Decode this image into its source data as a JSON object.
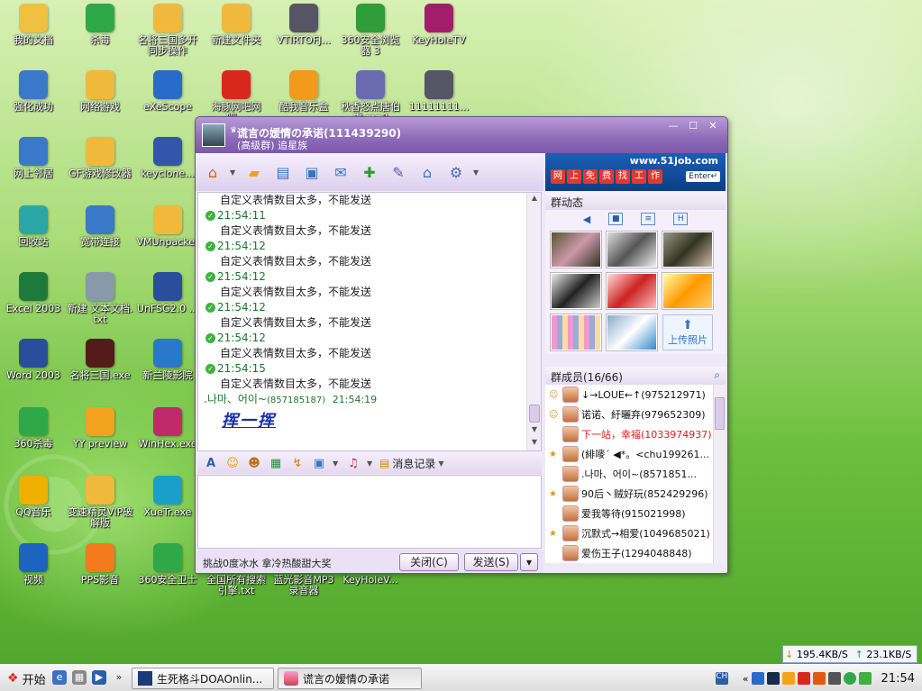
{
  "desktop_icons": [
    {
      "label": "我的文档",
      "icon": "documents-folder-icon",
      "color": "#f0c040"
    },
    {
      "label": "杀毒",
      "icon": "antivirus-icon",
      "color": "#2fa84a"
    },
    {
      "label": "名将三国多开同步操作",
      "icon": "folder-icon",
      "color": "#f1b93b"
    },
    {
      "label": "新建文件夹",
      "icon": "folder-icon",
      "color": "#f1b93b"
    },
    {
      "label": "VTIRTOFJ...",
      "icon": "jpg-image-icon",
      "color": "#556"
    },
    {
      "label": "360安全浏览器 3",
      "icon": "browser-icon",
      "color": "#2e9d3a"
    },
    {
      "label": "KeyHoleTV",
      "icon": "tv-icon",
      "color": "#a01e6a"
    },
    {
      "label": "强化成功",
      "icon": "computer-icon",
      "color": "#3a78c9"
    },
    {
      "label": "网络游戏",
      "icon": "folder-icon",
      "color": "#f1b93b"
    },
    {
      "label": "eXeScope",
      "icon": "exescope-icon",
      "color": "#2a6ac8"
    },
    {
      "label": "海豚网吧网吧...",
      "icon": "banner-icon",
      "color": "#d8281e"
    },
    {
      "label": "酷我音乐盒",
      "icon": "music-box-icon",
      "color": "#f39a1d"
    },
    {
      "label": "秋香怒点唐伯虎.mp3",
      "icon": "mp3-file-icon",
      "color": "#6b6bb0"
    },
    {
      "label": "11111111...",
      "icon": "gif-image-icon",
      "color": "#556"
    },
    {
      "label": "网上邻居",
      "icon": "network-icon",
      "color": "#3a78c9"
    },
    {
      "label": "GF游戏修改器",
      "icon": "folder-icon",
      "color": "#f1b93b"
    },
    {
      "label": "keyclone...",
      "icon": "cube-icon",
      "color": "#3355aa"
    },
    {
      "label": "回收站",
      "icon": "recycle-bin-icon",
      "color": "#2aa6a6"
    },
    {
      "label": "宽带连接",
      "icon": "broadband-icon",
      "color": "#3a78c9"
    },
    {
      "label": "VMUnpacker",
      "icon": "folder-icon",
      "color": "#f1b93b"
    },
    {
      "label": "Excel 2003",
      "icon": "excel-icon",
      "color": "#1e7a3a"
    },
    {
      "label": "新建 文本文档.txt",
      "icon": "text-file-icon",
      "color": "#8899aa"
    },
    {
      "label": "UnFSG2.0 ...",
      "icon": "window-app-icon",
      "color": "#2a4d9c"
    },
    {
      "label": "Word 2003",
      "icon": "word-icon",
      "color": "#2a4d9c"
    },
    {
      "label": "名将三国.exe",
      "icon": "game-icon",
      "color": "#551a1a"
    },
    {
      "label": "新兰陵影院",
      "icon": "cinema-icon",
      "color": "#2a78c9"
    },
    {
      "label": "360杀毒",
      "icon": "shield-icon",
      "color": "#2fa84a"
    },
    {
      "label": "YY preview",
      "icon": "yy-icon",
      "color": "#f3a21d"
    },
    {
      "label": "WinHex.exe",
      "icon": "hex-icon",
      "color": "#c02a6a"
    },
    {
      "label": "QQ音乐",
      "icon": "music-icon",
      "color": "#f0b000"
    },
    {
      "label": "变速精灵VIP破解版",
      "icon": "folder-icon",
      "color": "#f1b93b"
    },
    {
      "label": "XueTr.exe",
      "icon": "gear-icon",
      "color": "#1aa0c8"
    },
    {
      "label": "视频",
      "icon": "video-icon",
      "color": "#1e63c0"
    },
    {
      "label": "PPS影音",
      "icon": "pps-icon",
      "color": "#f37a1d"
    },
    {
      "label": "360安全卫士",
      "icon": "shield-plus-icon",
      "color": "#2fa84a"
    },
    {
      "label": "全国所有搜索引擎.txt",
      "icon": "text-file-icon",
      "color": "#8899aa"
    },
    {
      "label": "蓝光影音MP3录音器",
      "icon": "recorder-icon",
      "color": "#2a6ac8"
    },
    {
      "label": "KeyHoleV...",
      "icon": "tv-icon",
      "color": "#a01e6a"
    }
  ],
  "qq_window": {
    "title": "谎言の嫒情の承诺(111439290)",
    "subtitle": "(高级群) 追星族",
    "toolbar_icons": [
      "home-icon",
      "folder-share-icon",
      "album-icon",
      "card-icon",
      "mail-icon",
      "add-icon",
      "tools-icon",
      "hat-icon",
      "settings-icon"
    ],
    "ad": {
      "url": "www.51job.com",
      "chars": [
        "网",
        "上",
        "免",
        "费",
        "找",
        "工",
        "作"
      ],
      "enter": "Enter↵"
    },
    "messages": [
      {
        "time": "",
        "text": "自定义表情数目太多，不能发送"
      },
      {
        "time": "21:54:11",
        "text": "自定义表情数目太多，不能发送"
      },
      {
        "time": "21:54:12",
        "text": "自定义表情数目太多，不能发送"
      },
      {
        "time": "21:54:12",
        "text": "自定义表情数目太多，不能发送"
      },
      {
        "time": "21:54:12",
        "text": "自定义表情数目太多，不能发送"
      },
      {
        "time": "21:54:12",
        "text": "自定义表情数目太多，不能发送"
      },
      {
        "time": "21:54:15",
        "text": "自定义表情数目太多，不能发送"
      }
    ],
    "last_sender": ".나마、어이~",
    "last_sender_id": "(857185187)",
    "last_time": "21:54:19",
    "handwriting": "挥一挥",
    "history_label": "消息记录",
    "ticker": "挑战0度冰水 拿冷热酸甜大奖",
    "close_label": "关闭(C)",
    "send_label": "发送(S)",
    "group_activity_title": "群动态",
    "upload_label": "上传照片",
    "members_title": "群成员(16/66)",
    "members": [
      {
        "name": "↓→LOUE←↑(975212971)",
        "role": "admin",
        "red": false
      },
      {
        "name": "诺诺、紆曬弃(979652309)",
        "role": "admin",
        "red": false
      },
      {
        "name": "下一站，幸福(1033974937)",
        "role": "",
        "red": true
      },
      {
        "name": "(緋嘜ˊ ◀*。<chu199261...",
        "role": "star",
        "red": false
      },
      {
        "name": ".나마、어이~(8571851...",
        "role": "",
        "red": false
      },
      {
        "name": "90后丶贼好玩(852429296)",
        "role": "star",
        "red": false
      },
      {
        "name": "爱我等待(915021998)",
        "role": "",
        "red": false
      },
      {
        "name": "沉默式→相爱(1049685021)",
        "role": "star",
        "red": false
      },
      {
        "name": "爱伤王子(1294048848)",
        "role": "",
        "red": false
      }
    ]
  },
  "network": {
    "down": "195.4KB/S",
    "up": "23.1KB/S"
  },
  "taskbar": {
    "start_label": "开始",
    "tasks": [
      "生死格斗DOAOnlin...",
      "谎言の嫒情の承诺"
    ],
    "clock": "21:54",
    "tray_icons": [
      "ime-icon",
      "expand-icon",
      "tray-app-icon",
      "speaker-icon",
      "shield-tray-icon",
      "qq-tray-icon"
    ]
  }
}
